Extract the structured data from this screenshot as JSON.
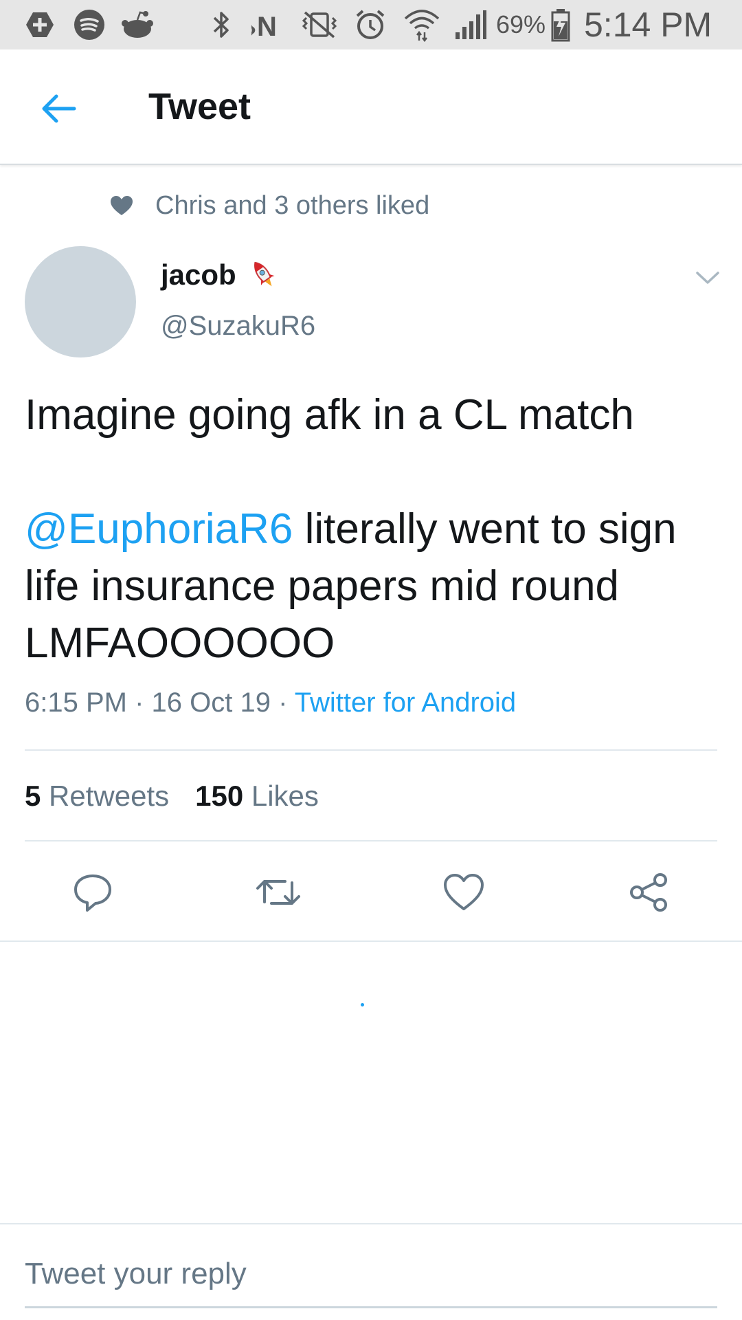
{
  "status_bar": {
    "icons": [
      "add-notification-icon",
      "spotify-icon",
      "reddit-icon",
      "bluetooth-icon",
      "nfc-icon",
      "vibrate-icon",
      "alarm-icon",
      "wifi-icon",
      "signal-icon",
      "battery-charging-icon"
    ],
    "battery": "69%",
    "time": "5:14 PM"
  },
  "app_bar": {
    "title": "Tweet",
    "back_icon": "arrow-left-icon"
  },
  "social_context": {
    "icon": "heart-icon",
    "text": "Chris and 3 others liked"
  },
  "author": {
    "name": "jacob",
    "emoji": "rocket",
    "handle": "@SuzakuR6"
  },
  "tweet": {
    "line1": "Imagine going afk in a CL match",
    "mention": "@EuphoriaR6",
    "rest": " literally went to sign life insurance papers mid round LMFAOOOOOO"
  },
  "meta": {
    "time": "6:15 PM",
    "date": "16 Oct 19",
    "separator": " · ",
    "source": "Twitter for Android"
  },
  "stats": {
    "retweets_count": "5",
    "retweets_label": "Retweets",
    "likes_count": "150",
    "likes_label": "Likes"
  },
  "actions": [
    "reply-icon",
    "retweet-icon",
    "like-icon",
    "share-icon"
  ],
  "reply": {
    "placeholder": "Tweet your reply"
  },
  "colors": {
    "accent": "#1da1f2",
    "secondary_text": "#657786",
    "primary_text": "#14171a"
  }
}
